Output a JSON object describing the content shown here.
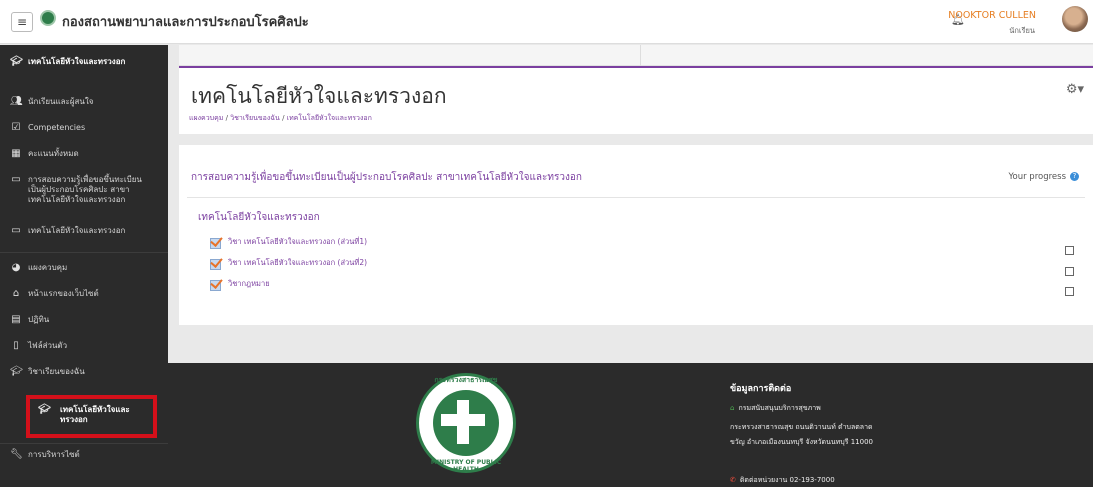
{
  "topbar": {
    "menu_icon": "hamburger-icon",
    "site_name": "กองสถานพยาบาลและการประกอบโรคศิลปะ",
    "notification_icon": "bell-icon",
    "user_name": "NOOKTOR CULLEN",
    "user_role": "นักเรียน"
  },
  "sidebar": {
    "items": [
      {
        "label": "เทคโนโลยีหัวใจและทรวงอก",
        "icon": "graduation-cap-icon"
      },
      {
        "label": "นักเรียนและผู้สนใจ",
        "icon": "users-icon"
      },
      {
        "label": "Competencies",
        "icon": "checkbox-icon"
      },
      {
        "label": "คะแนนทั้งหมด",
        "icon": "table-icon"
      },
      {
        "label": "การสอบความรู้เพื่อขอขึ้นทะเบียนเป็นผู้ประกอบโรคศิลปะ สาขาเทคโนโลยีหัวใจและทรวงอก",
        "icon": "folder-icon"
      },
      {
        "label": "เทคโนโลยีหัวใจและทรวงอก",
        "icon": "folder-icon"
      },
      {
        "label": "แผงควบคุม",
        "icon": "dashboard-icon"
      },
      {
        "label": "หน้าแรกของเว็บไซต์",
        "icon": "home-icon"
      },
      {
        "label": "ปฏิทิน",
        "icon": "calendar-icon"
      },
      {
        "label": "ไฟล์ส่วนตัว",
        "icon": "file-icon"
      },
      {
        "label": "วิชาเรียนของฉัน",
        "icon": "graduation-cap-icon"
      },
      {
        "label": "เทคโนโลยีหัวใจและทรวงอก",
        "icon": "graduation-cap-icon"
      },
      {
        "label": "การบริหารไซต์",
        "icon": "wrench-icon"
      }
    ]
  },
  "header": {
    "title": "เทคโนโลยีหัวใจและทรวงอก",
    "breadcrumb": [
      "แผงควบคุม",
      "วิชาเรียนของฉัน",
      "เทคโนโลยีหัวใจและทรวงอก"
    ],
    "separator": "/",
    "settings_icon": "gear-icon"
  },
  "course": {
    "title": "การสอบความรู้เพื่อขอขึ้นทะเบียนเป็นผู้ประกอบโรคศิลปะ สาขาเทคโนโลยีหัวใจและทรวงอก",
    "progress_label": "Your progress",
    "section_title": "เทคโนโลยีหัวใจและทรวงอก",
    "activities": [
      {
        "label": "วิชา เทคโนโลยีหัวใจและทรวงอก (ส่วนที่1)",
        "completed": false
      },
      {
        "label": "วิชา เทคโนโลยีหัวใจและทรวงอก (ส่วนที่2)",
        "completed": false
      },
      {
        "label": "วิชากฎหมาย",
        "completed": false
      }
    ]
  },
  "footer": {
    "seal_top": "กระทรวงสาธารณสุข",
    "seal_bottom": "MINISTRY OF PUBLIC HEALTH",
    "contact_title": "ข้อมูลการติดต่อ",
    "org": "กรมสนับสนุนบริการสุขภาพ",
    "address1": "กระทรวงสาธารณสุข ถนนติวานนท์ ตำบลตลาด",
    "address2": "ขวัญ อำเภอเมืองนนทบุรี จังหวัดนนทบุรี 11000",
    "phone": "ติดต่อหน่วยงาน 02-193-7000"
  }
}
